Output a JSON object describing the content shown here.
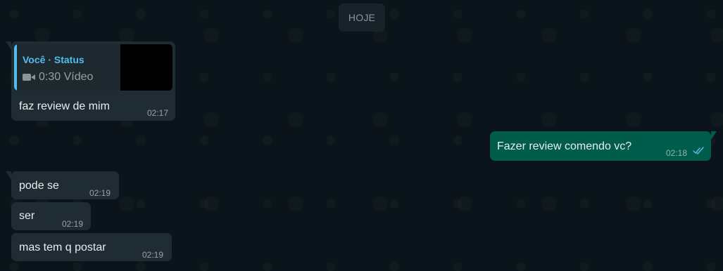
{
  "date_chip": "HOJE",
  "status_reply": {
    "author": "Você · Status",
    "media_label": "0:30 Vídeo",
    "media_icon": "video-camera-icon",
    "text": "faz review de mim",
    "time": "02:17"
  },
  "outgoing_message": {
    "text": "Fazer review comendo vc?",
    "time": "02:18",
    "status_icon": "double-check-read-icon"
  },
  "incoming_messages": [
    {
      "text": "pode se",
      "time": "02:19"
    },
    {
      "text": "ser",
      "time": "02:19"
    },
    {
      "text": "mas tem q postar",
      "time": "02:19"
    }
  ],
  "colors": {
    "background": "#0b141a",
    "incoming_bubble": "#202c33",
    "outgoing_bubble": "#005c4b",
    "status_accent": "#53bdeb",
    "read_check": "#53bdeb"
  }
}
